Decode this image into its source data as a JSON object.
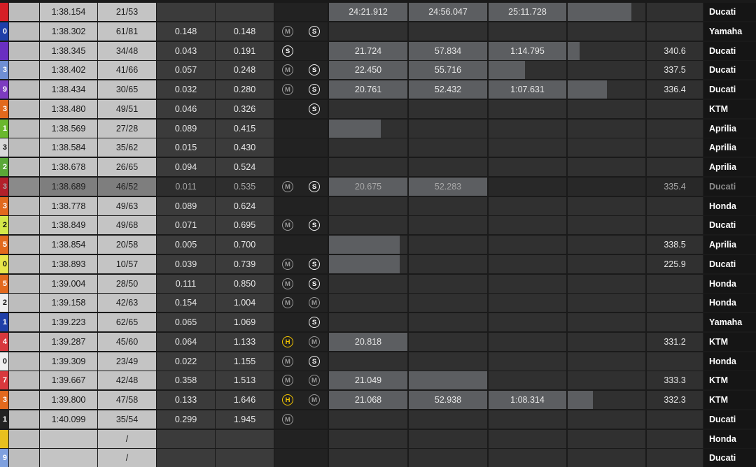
{
  "rows": [
    {
      "num": "",
      "lap": "1:38.154",
      "laps": "21/53",
      "gap": "",
      "prev": "",
      "tyres": [],
      "s1": "24:21.912",
      "s2": "24:56.047",
      "s3": "25:11.728",
      "s4_fill": 0.82,
      "speed": "",
      "team": "Ducati",
      "num_color": "#d61f26"
    },
    {
      "num": "0",
      "lap": "1:38.302",
      "laps": "61/81",
      "gap": "0.148",
      "prev": "0.148",
      "tyres": [
        "M",
        "S"
      ],
      "s1": "",
      "s2": "",
      "s3": "",
      "s4_fill": 0,
      "speed": "",
      "team": "Yamaha",
      "num_color": "#1f3fa8"
    },
    {
      "num": "",
      "lap": "1:38.345",
      "laps": "34/48",
      "gap": "0.043",
      "prev": "0.191",
      "tyres": [
        "S"
      ],
      "s1": "21.724",
      "s2": "57.834",
      "s3": "1:14.795",
      "s4_fill": 0.15,
      "speed": "340.6",
      "team": "Ducati",
      "num_color": "#6a2fc2"
    },
    {
      "num": "3",
      "lap": "1:38.402",
      "laps": "41/66",
      "gap": "0.057",
      "prev": "0.248",
      "tyres": [
        "M",
        "S"
      ],
      "s1": "22.450",
      "s2": "55.716",
      "s3": "",
      "s3_fill": 0.47,
      "s4_fill": 0,
      "speed": "337.5",
      "team": "Ducati",
      "num_color": "#6f8fd4"
    },
    {
      "num": "9",
      "lap": "1:38.434",
      "laps": "30/65",
      "gap": "0.032",
      "prev": "0.280",
      "tyres": [
        "M",
        "S"
      ],
      "s1": "20.761",
      "s2": "52.432",
      "s3": "1:07.631",
      "s4_fill": 0.5,
      "speed": "336.4",
      "team": "Ducati",
      "num_color": "#7d3bc0"
    },
    {
      "num": "3",
      "lap": "1:38.480",
      "laps": "49/51",
      "gap": "0.046",
      "prev": "0.326",
      "tyres": [
        "",
        "S"
      ],
      "s1": "",
      "s2": "",
      "s3": "",
      "s4_fill": 0,
      "speed": "",
      "team": "KTM",
      "num_color": "#e2691d"
    },
    {
      "num": "1",
      "lap": "1:38.569",
      "laps": "27/28",
      "gap": "0.089",
      "prev": "0.415",
      "tyres": [],
      "s1": "",
      "s1_fill": 0.66,
      "s2": "",
      "s3": "",
      "s4_fill": 0,
      "speed": "",
      "team": "Aprilia",
      "num_color": "#6ab82e"
    },
    {
      "num": "3",
      "lap": "1:38.584",
      "laps": "35/62",
      "gap": "0.015",
      "prev": "0.430",
      "tyres": [],
      "s1": "",
      "s2": "",
      "s3": "",
      "s4_fill": 0,
      "speed": "",
      "team": "Aprilia",
      "num_color": "#d9d9d9"
    },
    {
      "num": "2",
      "lap": "1:38.678",
      "laps": "26/65",
      "gap": "0.094",
      "prev": "0.524",
      "tyres": [],
      "s1": "",
      "s2": "",
      "s3": "",
      "s4_fill": 0,
      "speed": "",
      "team": "Aprilia",
      "num_color": "#5aa837"
    },
    {
      "num": "3",
      "lap": "1:38.689",
      "laps": "46/52",
      "gap": "0.011",
      "prev": "0.535",
      "tyres": [
        "M",
        "S"
      ],
      "s1": "20.675",
      "s2": "52.283",
      "s3": "",
      "s4_fill": 0,
      "speed": "335.4",
      "team": "Ducati",
      "num_color": "#b3202a",
      "dimmed": true
    },
    {
      "num": "3",
      "lap": "1:38.778",
      "laps": "49/63",
      "gap": "0.089",
      "prev": "0.624",
      "tyres": [],
      "s1": "",
      "s2": "",
      "s3": "",
      "s4_fill": 0,
      "speed": "",
      "team": "Honda",
      "num_color": "#e2691d"
    },
    {
      "num": "2",
      "lap": "1:38.849",
      "laps": "49/68",
      "gap": "0.071",
      "prev": "0.695",
      "tyres": [
        "M",
        "S"
      ],
      "s1": "",
      "s2": "",
      "s3": "",
      "s4_fill": 0,
      "speed": "",
      "team": "Ducati",
      "num_color": "#d4e84a"
    },
    {
      "num": "5",
      "lap": "1:38.854",
      "laps": "20/58",
      "gap": "0.005",
      "prev": "0.700",
      "tyres": [],
      "s1": "",
      "s1_fill": 0.9,
      "s2": "",
      "s3": "",
      "s4_fill": 0,
      "speed": "338.5",
      "team": "Aprilia",
      "num_color": "#e2691d"
    },
    {
      "num": "0",
      "lap": "1:38.893",
      "laps": "10/57",
      "gap": "0.039",
      "prev": "0.739",
      "tyres": [
        "M",
        "S"
      ],
      "s1": "",
      "s1_fill": 0.9,
      "s2": "",
      "s3": "",
      "s4_fill": 0,
      "speed": "225.9",
      "team": "Ducati",
      "num_color": "#e8e64a"
    },
    {
      "num": "5",
      "lap": "1:39.004",
      "laps": "28/50",
      "gap": "0.111",
      "prev": "0.850",
      "tyres": [
        "M",
        "S"
      ],
      "s1": "",
      "s2": "",
      "s3": "",
      "s4_fill": 0,
      "speed": "",
      "team": "Honda",
      "num_color": "#e2691d"
    },
    {
      "num": "2",
      "lap": "1:39.158",
      "laps": "42/63",
      "gap": "0.154",
      "prev": "1.004",
      "tyres": [
        "M",
        "M"
      ],
      "s1": "",
      "s2": "",
      "s3": "",
      "s4_fill": 0,
      "speed": "",
      "team": "Honda",
      "num_color": "#eeeeee"
    },
    {
      "num": "1",
      "lap": "1:39.223",
      "laps": "62/65",
      "gap": "0.065",
      "prev": "1.069",
      "tyres": [
        "",
        "S"
      ],
      "s1": "",
      "s2": "",
      "s3": "",
      "s4_fill": 0,
      "speed": "",
      "team": "Yamaha",
      "num_color": "#1f3fa8"
    },
    {
      "num": "4",
      "lap": "1:39.287",
      "laps": "45/60",
      "gap": "0.064",
      "prev": "1.133",
      "tyres": [
        "H",
        "M"
      ],
      "s1": "20.818",
      "s2": "",
      "s3": "",
      "s4_fill": 0,
      "speed": "331.2",
      "team": "KTM",
      "num_color": "#d8383d"
    },
    {
      "num": "0",
      "lap": "1:39.309",
      "laps": "23/49",
      "gap": "0.022",
      "prev": "1.155",
      "tyres": [
        "M",
        "S"
      ],
      "s1": "",
      "s2": "",
      "s3": "",
      "s4_fill": 0,
      "speed": "",
      "team": "Honda",
      "num_color": "#eeeeee"
    },
    {
      "num": "7",
      "lap": "1:39.667",
      "laps": "42/48",
      "gap": "0.358",
      "prev": "1.513",
      "tyres": [
        "M",
        "M"
      ],
      "s1": "21.049",
      "s2": "",
      "s2_fill": 1.0,
      "s3": "",
      "s4_fill": 0,
      "speed": "333.3",
      "team": "KTM",
      "num_color": "#d8383d"
    },
    {
      "num": "3",
      "lap": "1:39.800",
      "laps": "47/58",
      "gap": "0.133",
      "prev": "1.646",
      "tyres": [
        "H",
        "M"
      ],
      "s1": "21.068",
      "s2": "52.938",
      "s3": "1:08.314",
      "s4_fill": 0.32,
      "speed": "332.3",
      "team": "KTM",
      "num_color": "#e2691d"
    },
    {
      "num": "1",
      "lap": "1:40.099",
      "laps": "35/54",
      "gap": "0.299",
      "prev": "1.945",
      "tyres": [
        "M"
      ],
      "s1": "",
      "s2": "",
      "s3": "",
      "s4_fill": 0,
      "speed": "",
      "team": "Ducati",
      "num_color": "#222222"
    },
    {
      "num": "",
      "lap": "",
      "laps": "/",
      "gap": "",
      "prev": "",
      "tyres": [],
      "s1": "",
      "s2": "",
      "s3": "",
      "s4_fill": 0,
      "speed": "",
      "team": "Honda",
      "num_color": "#e8c01e"
    },
    {
      "num": "9",
      "lap": "",
      "laps": "/",
      "gap": "",
      "prev": "",
      "tyres": [],
      "s1": "",
      "s2": "",
      "s3": "",
      "s4_fill": 0,
      "speed": "",
      "team": "Ducati",
      "num_color": "#7fa0de"
    }
  ]
}
